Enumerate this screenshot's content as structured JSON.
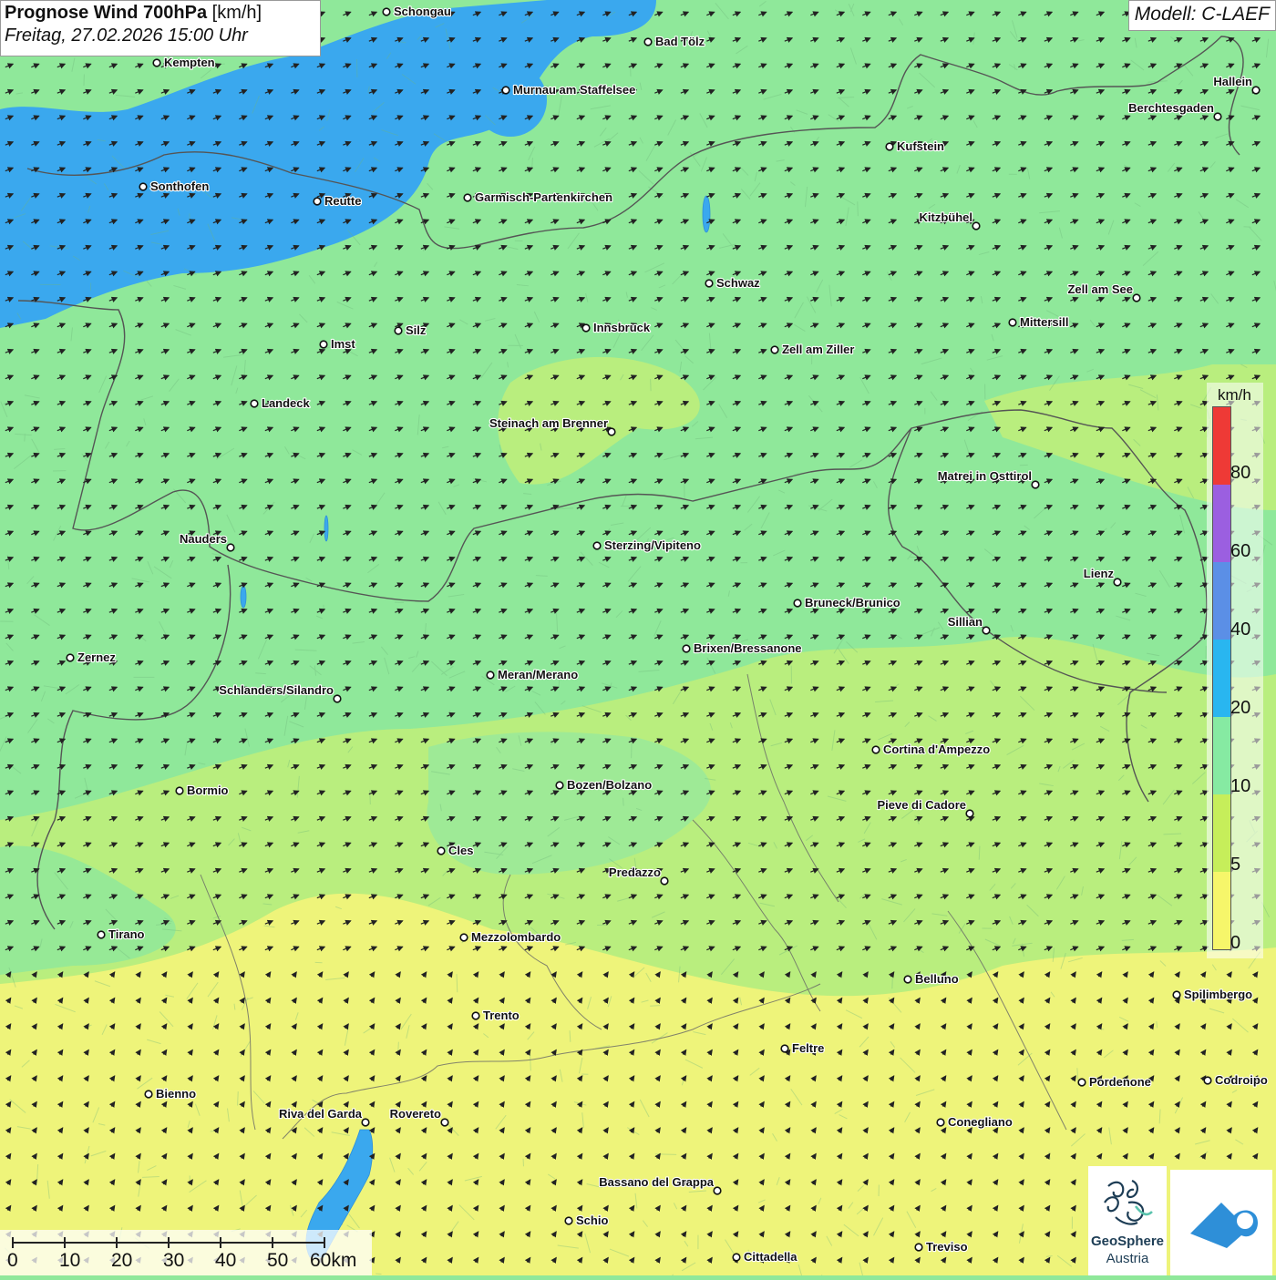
{
  "title": {
    "bold": "Prognose Wind 700hPa",
    "unit": " [km/h]",
    "subtitle": "Freitag, 27.02.2026 15:00 Uhr"
  },
  "model": "Modell: C-LAEF",
  "legend": {
    "unit": "km/h",
    "ticks": [
      "80",
      "60",
      "40",
      "20",
      "10",
      "5",
      "0"
    ],
    "colors": [
      "#ee3a36",
      "#9b5fe0",
      "#5b8fe6",
      "#29b6f0",
      "#86eaa2",
      "#c6ee5a",
      "#f6f66a"
    ]
  },
  "colors": {
    "blue_zone": "#3aa8ee",
    "green_zone": "#8fe89a",
    "lightgreen_zone": "#b9ee7e",
    "yellow_zone": "#eef47a",
    "accent": "#2e8fd8"
  },
  "cities": [
    "Schongau",
    "Bad Tölz",
    "Kempten",
    "Murnau am Staffelsee",
    "Hallein",
    "Berchtesgaden",
    "Kufstein",
    "Sonthofen",
    "Reutte",
    "Garmisch-Partenkirchen",
    "Kitzbühel",
    "Schwaz",
    "Zell am See",
    "Mittersill",
    "Imst",
    "Silz",
    "Innsbruck",
    "Zell am Ziller",
    "Landeck",
    "Steinach am Brenner",
    "Matrei in Osttirol",
    "Nauders",
    "Sterzing/Vipiteno",
    "Lienz",
    "Bruneck/Brunico",
    "Sillian",
    "Brixen/Bressanone",
    "Zernez",
    "Meran/Merano",
    "Schlanders/Silandro",
    "Cortina d'Ampezzo",
    "Bormio",
    "Bozen/Bolzano",
    "Pieve di Cadore",
    "Cles",
    "Predazzo",
    "Tirano",
    "Mezzolombardo",
    "Belluno",
    "Spilimbergo",
    "Trento",
    "Feltre",
    "Pordenone",
    "Codroipo",
    "Bienno",
    "Riva del Garda",
    "Rovereto",
    "Conegliano",
    "Bassano del Grappa",
    "Schio",
    "Treviso",
    "Cittadella"
  ],
  "scalebar": {
    "labels": [
      "0",
      "10",
      "20",
      "30",
      "40",
      "50",
      "60km"
    ]
  },
  "logo": {
    "name_line1": "GeoSphere",
    "name_line2": "Austria",
    "icon": "geosphere-logo-icon",
    "app_icon": "cloud-app-icon"
  },
  "wind": {
    "direction": "west-southwest"
  }
}
